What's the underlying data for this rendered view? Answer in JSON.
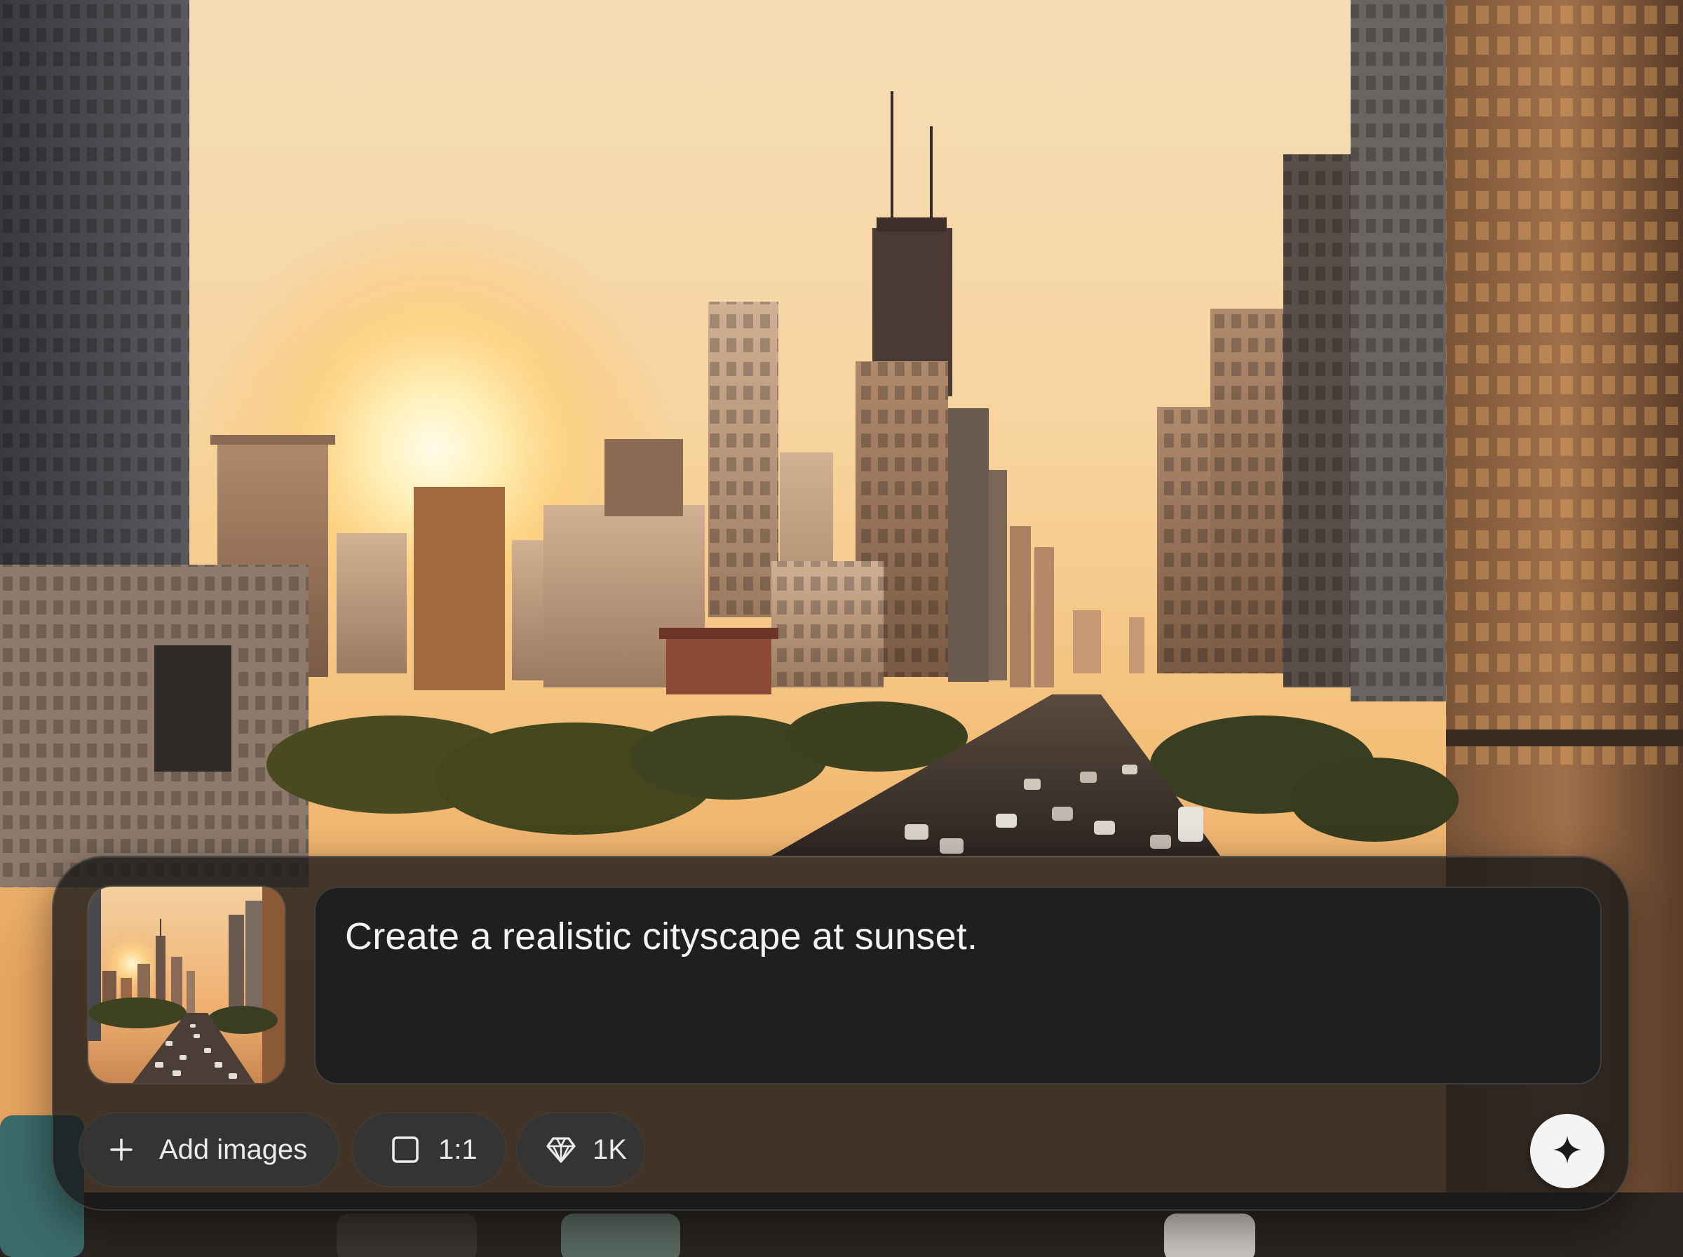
{
  "composer": {
    "prompt_text": "Create a realistic cityscape at sunset.",
    "add_images_label": "Add images",
    "aspect_ratio_label": "1:1",
    "resolution_label": "1K"
  },
  "icons": {
    "add": "plus-icon",
    "aspect_ratio": "square-icon",
    "resolution": "diamond-icon",
    "generate": "sparkle-icon"
  },
  "colors": {
    "panel_bg": "#181818",
    "prompt_bg": "#1f1f1f",
    "chip_bg": "#343434",
    "send_button_bg": "#f4f4f4",
    "text": "#f2f2f2"
  }
}
